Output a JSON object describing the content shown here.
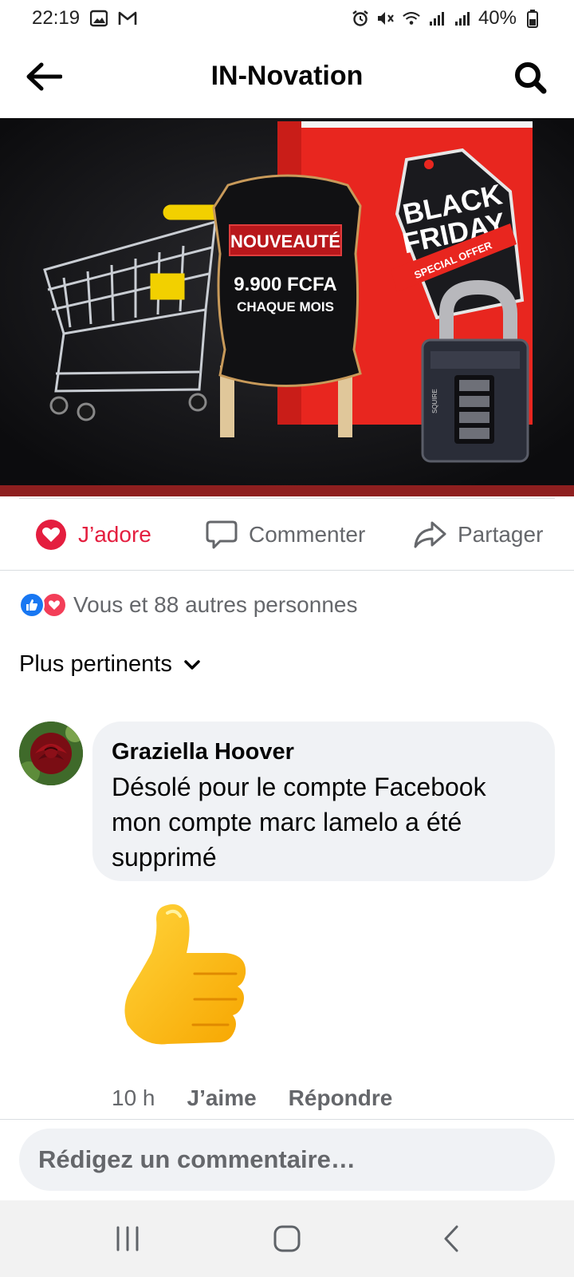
{
  "status_bar": {
    "time": "22:19",
    "battery": "40%",
    "left_icons": [
      "gallery-icon",
      "gmail-icon"
    ],
    "right_icons": [
      "alarm-icon",
      "mute-icon",
      "wifi-icon",
      "signal-icon",
      "signal-icon",
      "battery-icon"
    ]
  },
  "header": {
    "title": "IN-Novation",
    "back_icon": "arrow-left-icon",
    "search_icon": "search-icon"
  },
  "post_image": {
    "badge": "NOUVEAUTÉ",
    "price": "9.900 FCFA",
    "period": "CHAQUE MOIS",
    "tag_line1": "BLACK",
    "tag_line2": "FRIDAY",
    "tag_ribbon": "SPECIAL OFFER",
    "lock_brand": "SQUIRE"
  },
  "actions": {
    "like_label": "J’adore",
    "comment_label": "Commenter",
    "share_label": "Partager"
  },
  "reactions": {
    "summary": "Vous et 88 autres personnes",
    "icons": [
      "like-icon",
      "love-icon"
    ]
  },
  "sort": {
    "label": "Plus pertinents"
  },
  "comment": {
    "author": "Graziella Hoover",
    "text": "Désolé pour le compte Facebook mon compte marc lamelo a été supprimé",
    "time": "10 h",
    "like_label": "J’aime",
    "reply_label": "Répondre"
  },
  "composer": {
    "placeholder": "Rédigez un commentaire…"
  },
  "colors": {
    "love_red": "#e41e3f",
    "facebook_blue": "#1877f2",
    "text_secondary": "#65676b",
    "bubble_bg": "#f0f2f5"
  }
}
